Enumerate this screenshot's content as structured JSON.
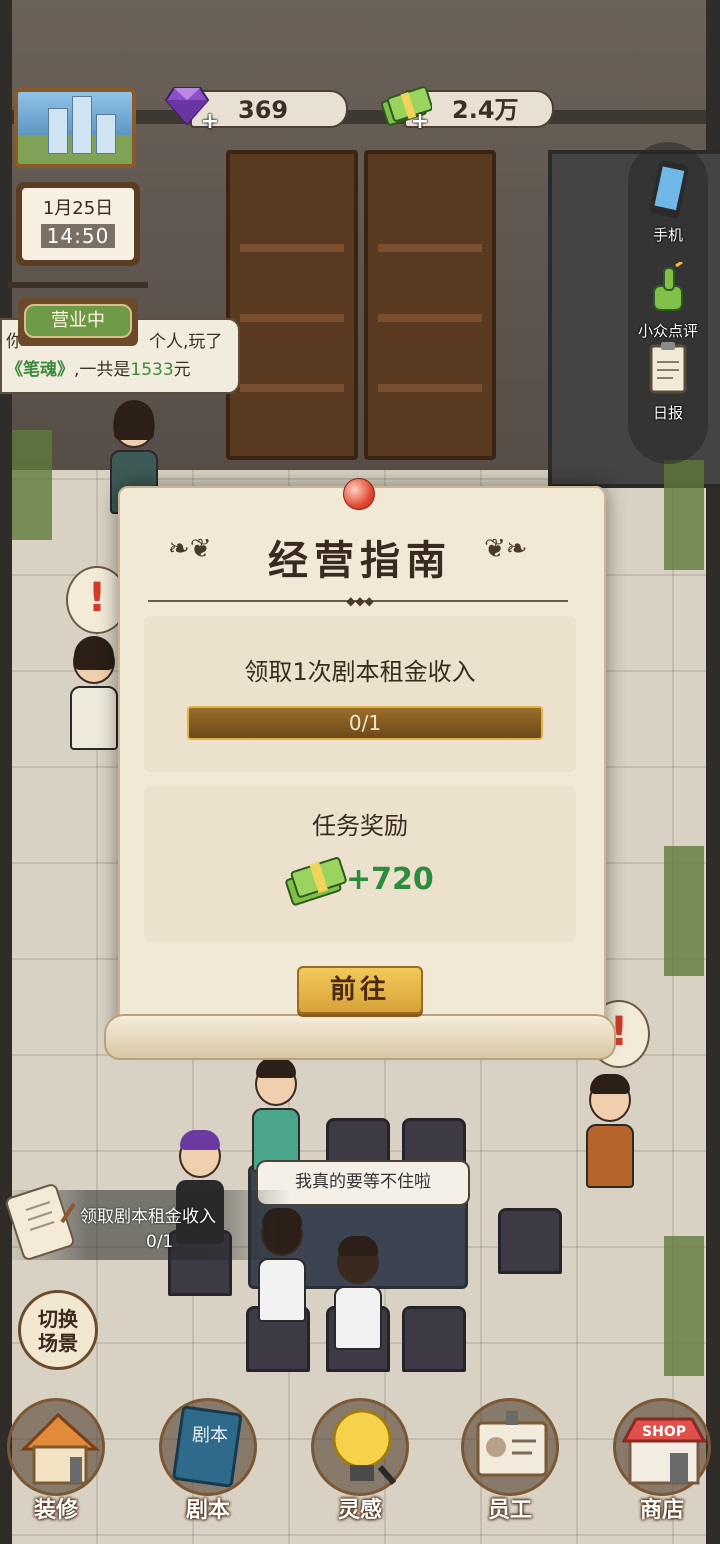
{
  "hud": {
    "gems": "369",
    "cash": "2.4万",
    "date": "1月25日",
    "time": "14:50",
    "open_status": "营业中"
  },
  "side_menu": {
    "phone": "手机",
    "reviews": "小众点评",
    "daily_report": "日报"
  },
  "notice": {
    "prefix": "你",
    "line1_suffix": "个人,玩了",
    "script_name": "《笔魂》",
    "line2_mid": ",一共是",
    "amount": "1533",
    "unit": "元"
  },
  "speech": "我真的要等不住啦",
  "tracker": {
    "label": "领取剧本租金收入",
    "progress": "0/1"
  },
  "switch_scene": {
    "line1": "切换",
    "line2": "场景"
  },
  "bottom_nav": [
    {
      "label": "装修",
      "icon": "house-icon"
    },
    {
      "label": "剧本",
      "icon": "script-book-icon"
    },
    {
      "label": "灵感",
      "icon": "lightbulb-icon"
    },
    {
      "label": "员工",
      "icon": "staff-badge-icon"
    },
    {
      "label": "商店",
      "icon": "shop-icon"
    }
  ],
  "modal": {
    "title": "经营指南",
    "task": "领取1次剧本租金收入",
    "progress_text": "0/1",
    "progress_fraction": 0,
    "reward_title": "任务奖励",
    "reward_amount": "+720",
    "go_button": "前往"
  },
  "colors": {
    "accent_gold": "#e2b24a",
    "reward_green": "#2c8c3c",
    "parchment": "#f1e8d6"
  }
}
